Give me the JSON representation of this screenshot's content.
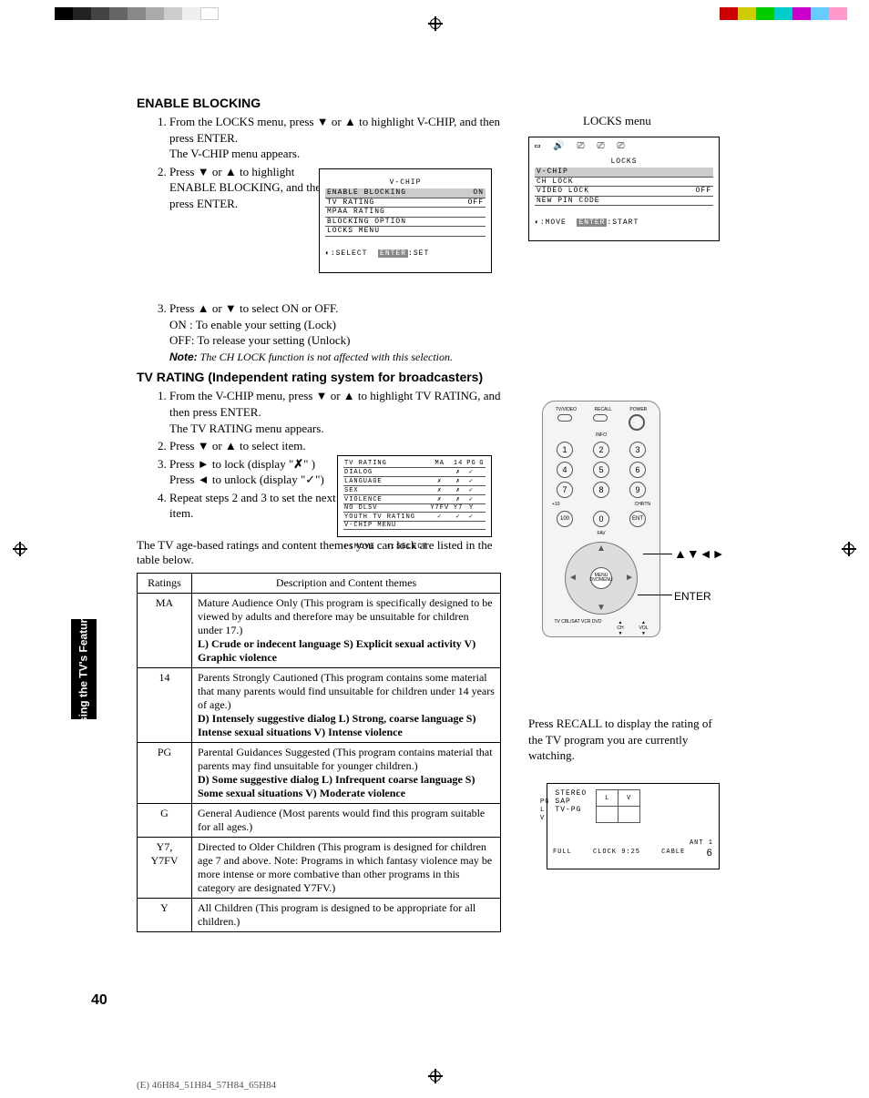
{
  "sideTab": "Using the TV's\nFeatures",
  "pageNum": "40",
  "footerModels": "(E) 46H84_51H84_57H84_65H84",
  "sec1": {
    "title": "ENABLE BLOCKING",
    "step1a": "From the LOCKS menu, press ",
    "step1b": " or ",
    "step1c": " to highlight V-CHIP, and then press ENTER.",
    "step1sub": "The V-CHIP menu appears.",
    "step2a": "Press ",
    "step2b": " or ",
    "step2c": " to highlight ENABLE BLOCKING, and then press ENTER.",
    "step3a": "Press ",
    "step3b": " or ",
    "step3c": " to select ON or OFF.",
    "step3on": "ON : To enable your setting (Lock)",
    "step3off": "OFF: To release your setting (Unlock)",
    "noteLabel": "Note:",
    "noteText": " The CH LOCK function is not affected with this selection."
  },
  "sec2": {
    "title": "TV RATING (Independent rating system for broadcasters)",
    "step1a": "From the V-CHIP menu, press ",
    "step1b": " or ",
    "step1c": " to highlight TV RATING, and then press ENTER.",
    "step1sub": "The TV RATING menu appears.",
    "step2a": "Press ",
    "step2b": " or ",
    "step2c": " to select item.",
    "step3a": "Press ",
    "step3b": " to lock (display \"",
    "step3c": "\" )",
    "step3d": "Press ",
    "step3e": " to unlock (display \"",
    "step3f": "\")",
    "lockGlyph": "✗",
    "unlockGlyph": "✓",
    "step4": "Repeat steps 2 and 3 to set the next item.",
    "tableIntro": "The TV age-based ratings and content themes you can lock are listed in the table below."
  },
  "ratingsTable": {
    "h1": "Ratings",
    "h2": "Description and Content themes",
    "rows": [
      {
        "r": "MA",
        "plain": "Mature Audience Only (This program is specifically designed to be viewed by adults and therefore may be unsuitable for children under 17.)",
        "bold": "L) Crude or indecent language  S) Explicit sexual activity  V) Graphic violence"
      },
      {
        "r": "14",
        "plain": "Parents Strongly Cautioned (This program contains some material that many parents would find unsuitable for children under 14 years of age.)",
        "bold": "D) Intensely suggestive dialog  L) Strong, coarse language  S) Intense sexual situations  V) Intense violence"
      },
      {
        "r": "PG",
        "plain": "Parental Guidances Suggested (This program contains material that parents may find unsuitable for younger children.)",
        "bold": "D) Some suggestive dialog  L) Infrequent coarse language  S) Some sexual situations  V) Moderate violence"
      },
      {
        "r": "G",
        "plain": "General Audience (Most parents would find this program suitable for all ages.)",
        "bold": ""
      },
      {
        "r": "Y7, Y7FV",
        "plain": "Directed to Older Children (This program is designed for children age 7 and above. Note: Programs in which fantasy violence may be more intense or more combative than other programs in this category are designated Y7FV.)",
        "bold": ""
      },
      {
        "r": "Y",
        "plain": "All Children (This program is designed to be appropriate for all children.)",
        "bold": ""
      }
    ]
  },
  "locksMenu": {
    "caption": "LOCKS menu",
    "title": "LOCKS",
    "rows": [
      {
        "l": "V-CHIP",
        "r": ""
      },
      {
        "l": "CH LOCK",
        "r": ""
      },
      {
        "l": "VIDEO LOCK",
        "r": "OFF"
      },
      {
        "l": "NEW PIN CODE",
        "r": ""
      }
    ],
    "foot1": ":MOVE",
    "foot2": "ENTER",
    "foot3": ":START"
  },
  "vchipMenu": {
    "title": "V-CHIP",
    "rows": [
      {
        "l": "ENABLE BLOCKING",
        "r": "ON"
      },
      {
        "l": "TV RATING",
        "r": "OFF"
      },
      {
        "l": "MPAA RATING",
        "r": ""
      },
      {
        "l": "BLOCKING OPTION",
        "r": ""
      },
      {
        "l": "LOCKS MENU",
        "r": ""
      }
    ],
    "foot1": ":SELECT",
    "foot2": "ENTER",
    "foot3": ":SET"
  },
  "tvrMenu": {
    "headers": [
      "TV RATING",
      "MA",
      "14",
      "PG",
      "G"
    ],
    "rows": [
      {
        "l": "DIALOG",
        "c": [
          "",
          "✗",
          "✓",
          ""
        ]
      },
      {
        "l": "LANGUAGE",
        "c": [
          "✗",
          "✗",
          "✓",
          ""
        ]
      },
      {
        "l": "SEX",
        "c": [
          "✗",
          "✗",
          "✓",
          ""
        ]
      },
      {
        "l": "VIOLENCE",
        "c": [
          "✗",
          "✗",
          "✓",
          ""
        ]
      },
      {
        "l": "NO DLSV",
        "c": [
          "Y7FV",
          "Y7",
          "Y",
          ""
        ]
      },
      {
        "l": "YOUTH TV RATING",
        "c": [
          "✓",
          "✓",
          "✓",
          ""
        ]
      },
      {
        "l": "V-CHIP MENU",
        "c": [
          "",
          "",
          "",
          ""
        ]
      }
    ],
    "foot1": ":MOVE",
    "foot2": ":SELECT"
  },
  "remote": {
    "topLabels": [
      "TV/VIDEO",
      "RECALL",
      "POWER"
    ],
    "info": "INFO",
    "nums": [
      "1",
      "2",
      "3",
      "4",
      "5",
      "6",
      "7",
      "8",
      "9",
      "100",
      "0",
      "ENT"
    ],
    "plus10": "+10",
    "chrtn": "CHRTN",
    "fav": "FAV",
    "center1": "MENU",
    "center2": "DVDMENU",
    "bottomLeft": "TV\nCBL/SAT\nVCR\nDVD",
    "ch": "CH",
    "vol": "VOL",
    "callArrows": "▲▼◄►",
    "callEnter": "ENTER"
  },
  "recallText": "Press RECALL to display the rating of the TV program you are currently watching.",
  "statusOsd": {
    "lines": [
      "STEREO",
      "SAP",
      "TV-PG"
    ],
    "sideLabels": [
      "PG",
      "L",
      "V"
    ],
    "cols": [
      "L",
      "V"
    ],
    "full": "FULL",
    "ant": "ANT 1",
    "clock": "CLOCK 9:25",
    "cable": "CABLE",
    "ch": "6"
  }
}
